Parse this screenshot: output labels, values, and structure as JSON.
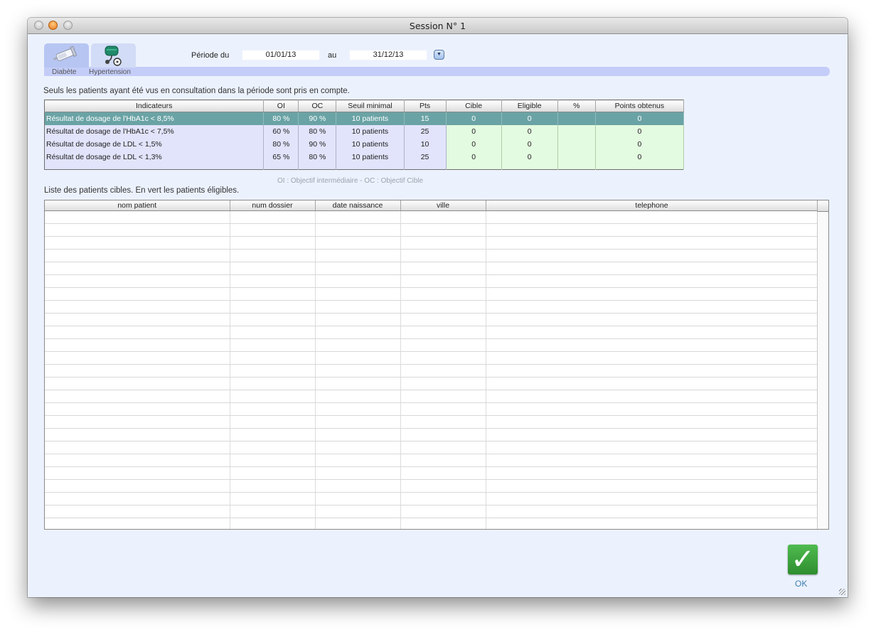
{
  "window": {
    "title": "Session N° 1"
  },
  "tabs": [
    {
      "label": "Diabète",
      "icon": "syringe-icon",
      "selected": true
    },
    {
      "label": "Hypertension",
      "icon": "blood-pressure-cuff-icon",
      "selected": false
    }
  ],
  "period": {
    "from_label": "Période du",
    "from_value": "01/01/13",
    "to_label": "au",
    "to_value": "31/12/13",
    "dropdown_icon": "chevron-down-icon"
  },
  "info_text": "Seuls les patients ayant été vus en consultation dans la période sont pris en compte.",
  "indicators": {
    "columns": [
      "Indicateurs",
      "OI",
      "OC",
      "Seuil minimal",
      "Pts",
      "Cible",
      "Eligible",
      "%",
      "Points obtenus"
    ],
    "rows": [
      {
        "name": "Résultat de dosage de l'HbA1c < 8,5%",
        "oi": "80 %",
        "oc": "90 %",
        "seuil": "10 patients",
        "pts": "15",
        "cible": "0",
        "eligible": "0",
        "pct": "",
        "points": "0",
        "selected": true
      },
      {
        "name": "Résultat de dosage de l'HbA1c < 7,5%",
        "oi": "60 %",
        "oc": "80 %",
        "seuil": "10 patients",
        "pts": "25",
        "cible": "0",
        "eligible": "0",
        "pct": "",
        "points": "0",
        "selected": false
      },
      {
        "name": "Résultat de dosage de LDL < 1,5%",
        "oi": "80 %",
        "oc": "90 %",
        "seuil": "10 patients",
        "pts": "10",
        "cible": "0",
        "eligible": "0",
        "pct": "",
        "points": "0",
        "selected": false
      },
      {
        "name": "Résultat de dosage de LDL < 1,3%",
        "oi": "65 %",
        "oc": "80 %",
        "seuil": "10 patients",
        "pts": "25",
        "cible": "0",
        "eligible": "0",
        "pct": "",
        "points": "0",
        "selected": false
      }
    ]
  },
  "legend": "OI : Objectif intermédiaire - OC : Objectif Cible",
  "patients": {
    "caption": "Liste des patients cibles. En vert les patients éligibles.",
    "columns": [
      "nom patient",
      "num dossier",
      "date naissance",
      "ville",
      "telephone"
    ],
    "rows": []
  },
  "ok_button": {
    "label": "OK",
    "icon": "checkmark-icon"
  },
  "colors": {
    "selected_row": "#6aa3a5",
    "indicator_row": "#e2e4fb",
    "result_cells": "#e3fbe0",
    "ok_button": "#3aa63a",
    "tab_band": "#c4cdf8"
  }
}
